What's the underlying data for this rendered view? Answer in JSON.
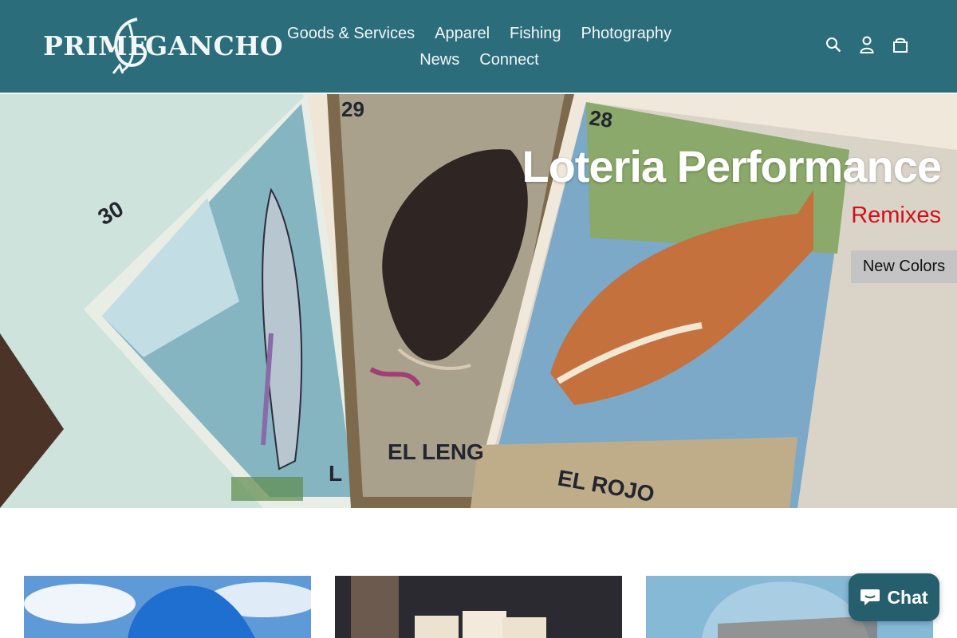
{
  "brand": {
    "logo_left": "PRIME",
    "logo_right": "GANCHO",
    "header_color": "#2b6d7b"
  },
  "nav": {
    "row1": [
      "Goods & Services",
      "Apparel",
      "Fishing",
      "Photography"
    ],
    "row2": [
      "News",
      "Connect"
    ]
  },
  "header_icons": [
    "search-icon",
    "user-icon",
    "cart-icon"
  ],
  "hero": {
    "title": "Loteria Performance",
    "subtitle": "Remixes",
    "subtitle_color": "#d3101a",
    "button_label": "New Colors",
    "card_numbers": [
      "30",
      "29",
      "28"
    ],
    "card_names": [
      "L",
      "EL LENG",
      "EL ROJO"
    ]
  },
  "chat": {
    "label": "Chat",
    "icon": "chat-bubble-icon"
  }
}
